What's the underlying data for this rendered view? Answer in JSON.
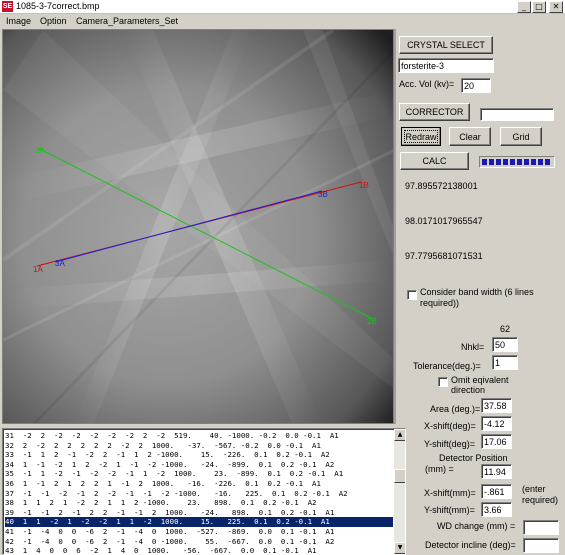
{
  "window": {
    "title": "1085-3-7correct.bmp",
    "app_icon_text": "SE",
    "controls": {
      "minimize": "_",
      "maximize": "□",
      "close": "✕"
    }
  },
  "menu": {
    "items": [
      "Image",
      "Option",
      "Camera_Parameters_Set"
    ]
  },
  "overlay": {
    "labels": {
      "p1a": "1A",
      "p2a": "2A",
      "p3a": "3A",
      "p1b": "1B",
      "p2b": "2B",
      "p3b": "3B"
    },
    "colors": {
      "line1": "#d01010",
      "line2": "#20c020",
      "line3": "#2020d0"
    }
  },
  "panel": {
    "crystal_select_label": "CRYSTAL SELECT",
    "crystal_name": "forsterite-3",
    "acc_vol_label": "Acc. Vol (kv)=",
    "acc_vol_value": "20",
    "corrector_label": "CORRECTOR",
    "corrector_value": "",
    "redraw_label": "Redraw",
    "clear_label": "Clear",
    "grid_label": "Grid",
    "calc_label": "CALC",
    "calc_progress_percent": 100,
    "result_1": "97.895572138001",
    "result_2": "98.0171017965547",
    "result_3": "97.7795681071531",
    "band_width_label_1": "Consider band width (6 lines",
    "band_width_label_2": "required))",
    "nhkl_top": "62",
    "nhkl_label": "Nhkl=",
    "nhkl_value": "50",
    "tolerance_label": "Tolerance(deg.)=",
    "tolerance_value": "1",
    "omit_label_1": "Omit eqivalent",
    "omit_label_2": "direction",
    "area_label": "Area (deg.)=",
    "area_value": "37.58",
    "xshift_deg_label": "X-shift(deg)=",
    "xshift_deg_value": "-4.12",
    "yshift_deg_label": "Y-shift(deg)=",
    "yshift_deg_value": "17.06",
    "detector_pos_label_1": "Detector Position",
    "detector_pos_label_2": "(mm) =",
    "detector_pos_value": "11.94",
    "xshift_mm_label": "X-shift(mm)=",
    "xshift_mm_value": "-.861",
    "enter_label_1": "(enter",
    "enter_label_2": "required)",
    "yshift_mm_label": "Y-shift(mm)=",
    "yshift_mm_value": "3.66",
    "wd_change_label": "WD change (mm) =",
    "wd_change_value": "",
    "detector_incline_label": "Detector incline (deg)=",
    "detector_incline_value": ""
  },
  "list": {
    "selected_index": 9,
    "rows": [
      "31  -2  2  -2  -2  -2  -2  -2  2  -2  519.    40. -1000. -0.2  0.0 -0.1  A1",
      "32  2  -2  2  2  2  2  2  -2  2  1000.   -37.  -567. -0.2  0.0 -0.1  A1",
      "33  -1  1  2  -1  -2  2  -1  1  2 -1000.    15.  -226.  0.1  0.2 -0.1  A2",
      "34  1  -1  -2  1  2  -2  1  -1  -2 -1000.   -24.  -899.  0.1  0.2 -0.1  A2",
      "35  -1  1  -2  -1  -2  -2  -1  1  -2  1000.    23.  -899.  0.1  0.2 -0.1  A1",
      "36  1  -1  2  1  2  2  1  -1  2  1000.   -16.  -226.  0.1  0.2 -0.1  A1",
      "37  -1  -1  -2  -1  2  -2  -1  -1  -2 -1000.   -16.   225.  0.1  0.2 -0.1  A2",
      "38  1  1  2  1  -2  2  1  1  2 -1000.    23.   898.  0.1  0.2 -0.1  A2",
      "39  -1  -1  2  -1  2  2  -1  -1  2  1000.   -24.   898.  0.1  0.2 -0.1  A1",
      "40  1  1  -2  1  -2  -2  1  1  -2  1000.    15.   225.  0.1  0.2 -0.1  A1",
      "41  -1  -4  0  0  -6  2  -1  -4  0  1000.  -527.  -869.  0.0  0.1 -0.1  A1",
      "42  -1  -4  0  0  -6  2  -1  -4  0 -1000.    55.  -667.  0.0  0.1 -0.1  A2",
      "43  1  4  0  0  6  -2  1  4  0  1000.   -56.  -667.  0.0  0.1 -0.1  A1"
    ]
  },
  "icons": {
    "scroll_up": "▲",
    "scroll_down": "▼",
    "checkbox": "checkbox-icon"
  }
}
